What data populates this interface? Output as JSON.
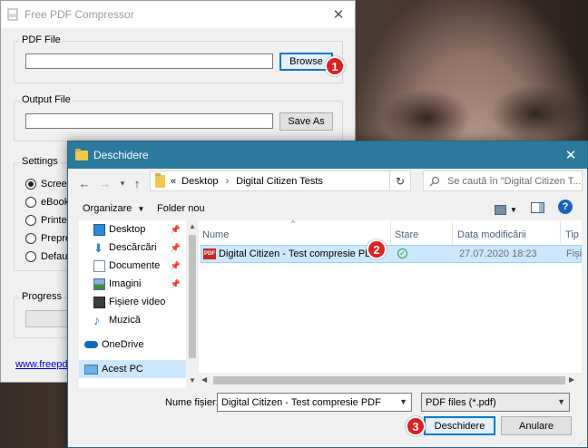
{
  "compressor_window": {
    "title": "Free PDF Compressor",
    "pdf_file_label": "PDF File",
    "browse_label": "Browse",
    "output_file_label": "Output File",
    "save_as_label": "Save As",
    "settings_label": "Settings",
    "settings_options": [
      "Screen",
      "eBook -",
      "Printer -",
      "Prepress",
      "Default"
    ],
    "progress_label": "Progress",
    "link_text": "www.freepdfco"
  },
  "open_dialog": {
    "title": "Deschidere",
    "breadcrumb": {
      "overflow": "«",
      "items": [
        "Desktop",
        "Digital Citizen Tests"
      ]
    },
    "search_placeholder": "Se caută în \"Digital Citizen T...",
    "toolbar": {
      "organize_label": "Organizare",
      "new_folder_label": "Folder nou"
    },
    "nav_items": [
      {
        "label": "Desktop",
        "icon": "desktop-icon",
        "pinned": true
      },
      {
        "label": "Descărcări",
        "icon": "downloads-icon",
        "pinned": true
      },
      {
        "label": "Documente",
        "icon": "documents-icon",
        "pinned": true
      },
      {
        "label": "Imagini",
        "icon": "pictures-icon",
        "pinned": true
      },
      {
        "label": "Fișiere video",
        "icon": "videos-icon",
        "pinned": false
      },
      {
        "label": "Muzică",
        "icon": "music-icon",
        "pinned": false
      },
      {
        "label": "OneDrive",
        "icon": "onedrive-icon",
        "pinned": false
      },
      {
        "label": "Acest PC",
        "icon": "this-pc-icon",
        "pinned": false
      }
    ],
    "columns": {
      "name": "Nume",
      "status": "Stare",
      "date_modified": "Data modificării",
      "type": "Tip"
    },
    "files": [
      {
        "name": "Digital Citizen - Test compresie PDF",
        "status": "synced",
        "date_modified": "27.07.2020 18:23",
        "type": "Fișie"
      }
    ],
    "filename_label": "Nume fișier:",
    "filename_value": "Digital Citizen - Test compresie PDF",
    "filter_value": "PDF files (*.pdf)",
    "open_label": "Deschidere",
    "cancel_label": "Anulare"
  },
  "step_badges": [
    "1",
    "2",
    "3"
  ],
  "colors": {
    "dialog_titlebar": "#2a7a9e",
    "selection": "#cce8ff",
    "badge": "#e02020"
  }
}
